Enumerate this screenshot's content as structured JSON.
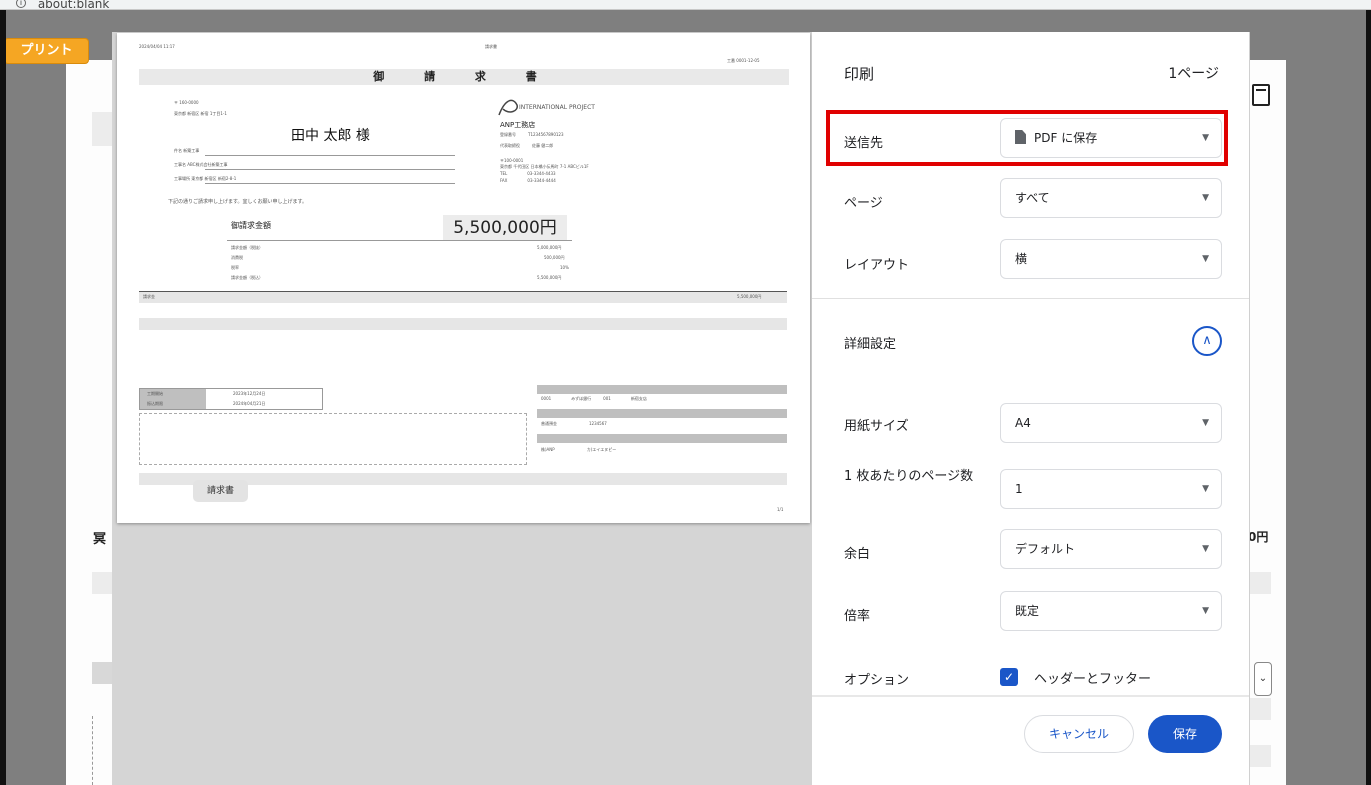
{
  "browser": {
    "address": "about:blank",
    "info_glyph": "i"
  },
  "underlying": {
    "print_button": "プリント",
    "left_fragment": "冥",
    "right_fragment": "0円",
    "select_glyph": "⌄"
  },
  "preview": {
    "doc_title": "御 請 求 書",
    "postal": "〒 160-0000",
    "customer_name": "田中 太郎 様",
    "greeting": "下記の通りご請求申し上げます。宜しくお願い申し上げます。",
    "company_logo": "INTERNATIONAL PROJECT",
    "company_name": "ANP工務店",
    "amount_label": "御請求金額",
    "amount_value": "5,500,000円",
    "tag": "請求書"
  },
  "panel": {
    "title": "印刷",
    "page_count": "1ページ",
    "rows": {
      "destination": {
        "label": "送信先",
        "value": "PDF に保存"
      },
      "pages": {
        "label": "ページ",
        "value": "すべて"
      },
      "layout": {
        "label": "レイアウト",
        "value": "横"
      },
      "advanced": {
        "label": "詳細設定"
      },
      "paper": {
        "label": "用紙サイズ",
        "value": "A4"
      },
      "per_sheet": {
        "label": "1 枚あたりのページ数",
        "value": "1"
      },
      "margin": {
        "label": "余白",
        "value": "デフォルト"
      },
      "scale": {
        "label": "倍率",
        "value": "既定"
      },
      "options": {
        "label": "オプション",
        "value": "ヘッダーとフッター",
        "checked": true
      }
    },
    "cancel": "キャンセル",
    "save": "保存"
  },
  "colors": {
    "accent": "#1a56c8",
    "highlight": "#e00000",
    "print_button": "#f5a623"
  }
}
